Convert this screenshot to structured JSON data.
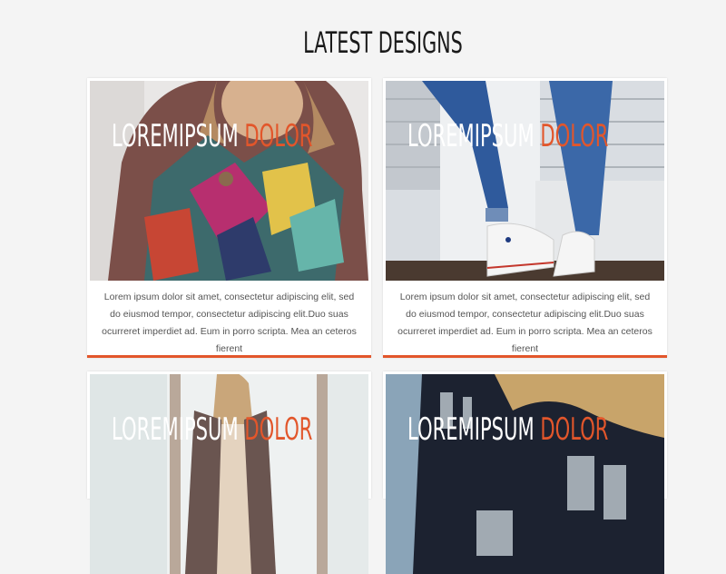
{
  "section": {
    "title": "LATEST DESIGNS"
  },
  "colors": {
    "accent": "#e2562b",
    "background": "#f4f4f4"
  },
  "cards": [
    {
      "title_white": "LOREMIPSUM",
      "title_accent": "DOLOR",
      "description": "Lorem ipsum dolor sit amet, consectetur adipiscing elit, sed do eiusmod tempor, consectetur adipiscing elit.Duo suas ocurreret imperdiet ad. Eum in porro scripta. Mea an ceteros fierent",
      "image": "woman-colorful-poncho-photo"
    },
    {
      "title_white": "LOREMIPSUM",
      "title_accent": "DOLOR",
      "description": "Lorem ipsum dolor sit amet, consectetur adipiscing elit, sed do eiusmod tempor, consectetur adipiscing elit.Duo suas ocurreret imperdiet ad. Eum in porro scripta. Mea an ceteros fierent",
      "image": "jeans-white-sneakers-photo"
    },
    {
      "title_white": "LOREMIPSUM",
      "title_accent": "DOLOR",
      "description": "",
      "image": "woman-cardigan-window-photo"
    },
    {
      "title_white": "LOREMIPSUM",
      "title_accent": "DOLOR",
      "description": "",
      "image": "graphic-tee-blonde-photo"
    }
  ]
}
